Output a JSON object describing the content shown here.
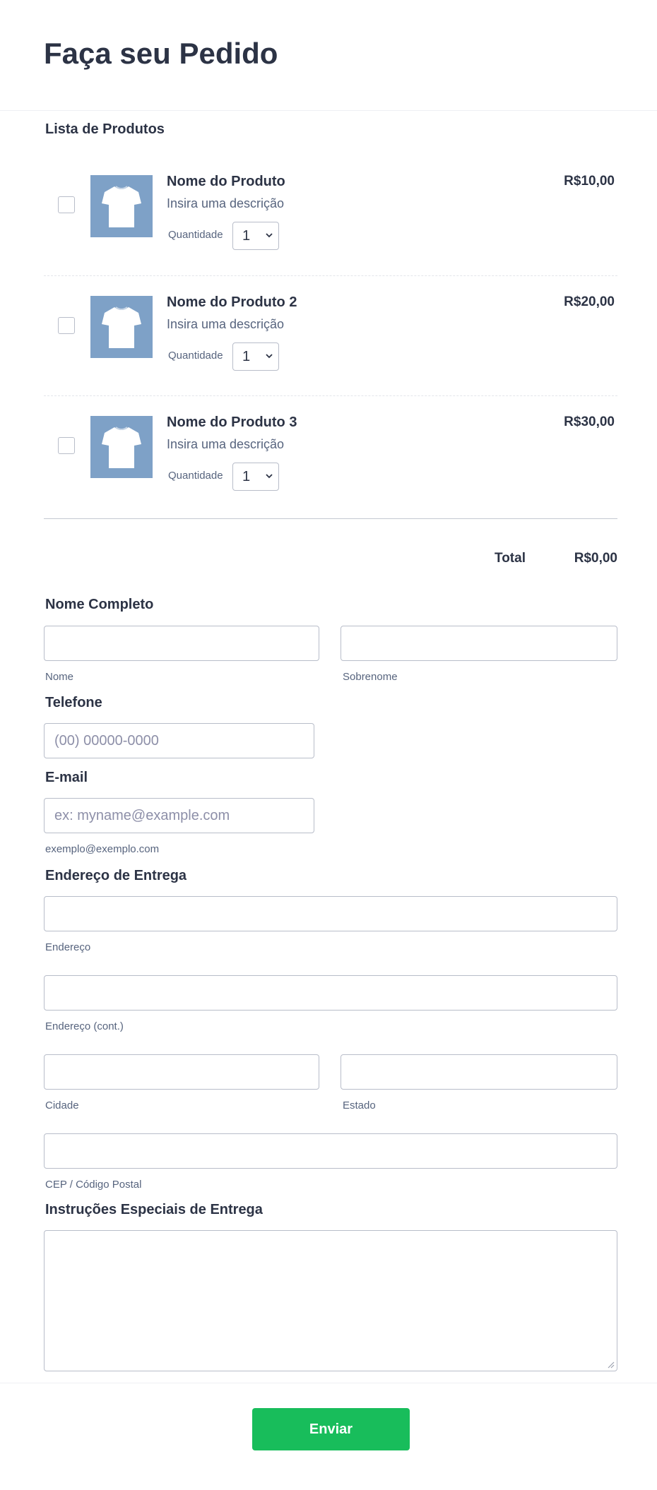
{
  "form": {
    "title": "Faça seu Pedido",
    "products_label": "Lista de Produtos",
    "products": [
      {
        "name": "Nome do Produto",
        "description": "Insira uma descrição",
        "quantity_label": "Quantidade",
        "quantity": "1",
        "price": "R$10,00",
        "image": "tshirt-icon",
        "checked": false
      },
      {
        "name": "Nome do Produto 2",
        "description": "Insira uma descrição",
        "quantity_label": "Quantidade",
        "quantity": "1",
        "price": "R$20,00",
        "image": "tshirt-icon",
        "checked": false
      },
      {
        "name": "Nome do Produto 3",
        "description": "Insira uma descrição",
        "quantity_label": "Quantidade",
        "quantity": "1",
        "price": "R$30,00",
        "image": "tshirt-icon",
        "checked": false
      }
    ],
    "total_label": "Total",
    "total_value": "R$0,00",
    "full_name": {
      "label": "Nome Completo",
      "first_sublabel": "Nome",
      "last_sublabel": "Sobrenome",
      "first_value": "",
      "last_value": ""
    },
    "phone": {
      "label": "Telefone",
      "placeholder": "(00) 00000-0000",
      "value": ""
    },
    "email": {
      "label": "E-mail",
      "placeholder": "ex: myname@example.com",
      "sublabel": "exemplo@exemplo.com",
      "value": ""
    },
    "address": {
      "label": "Endereço de Entrega",
      "line1_sublabel": "Endereço",
      "line2_sublabel": "Endereço (cont.)",
      "city_sublabel": "Cidade",
      "state_sublabel": "Estado",
      "zip_sublabel": "CEP / Código Postal"
    },
    "instructions": {
      "label": "Instruções Especiais de Entrega",
      "value": ""
    },
    "submit_label": "Enviar"
  },
  "colors": {
    "submit": "#18bd5b",
    "product_image_bg": "#7ea1c7",
    "text": "#2c3345",
    "border": "#b8bdc9"
  }
}
